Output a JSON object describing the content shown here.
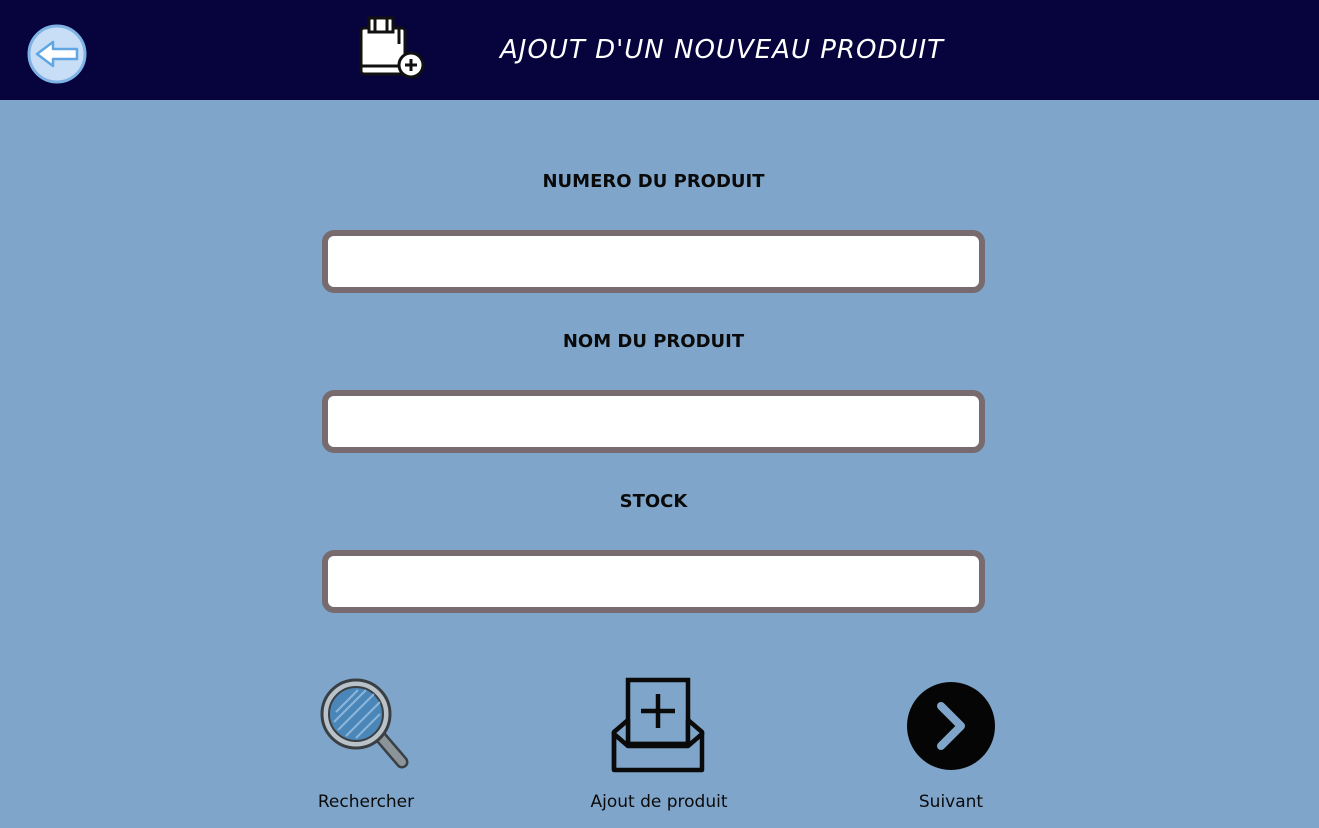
{
  "header": {
    "title": "AJOUT D'UN NOUVEAU PRODUIT",
    "back_icon": "back-arrow-icon",
    "title_icon": "shopping-bag-add-icon",
    "background_color": "#07033c"
  },
  "form": {
    "fields": [
      {
        "label": "NUMERO DU PRODUIT",
        "value": ""
      },
      {
        "label": "NOM DU PRODUIT",
        "value": ""
      },
      {
        "label": "STOCK",
        "value": ""
      }
    ],
    "border_color": "#776b6f"
  },
  "actions": [
    {
      "label": "Rechercher",
      "icon": "magnifier-icon"
    },
    {
      "label": "Ajout de produit",
      "icon": "inbox-add-icon"
    },
    {
      "label": "Suivant",
      "icon": "chevron-right-circle-icon"
    }
  ],
  "colors": {
    "page_background": "#7fa6ca"
  }
}
